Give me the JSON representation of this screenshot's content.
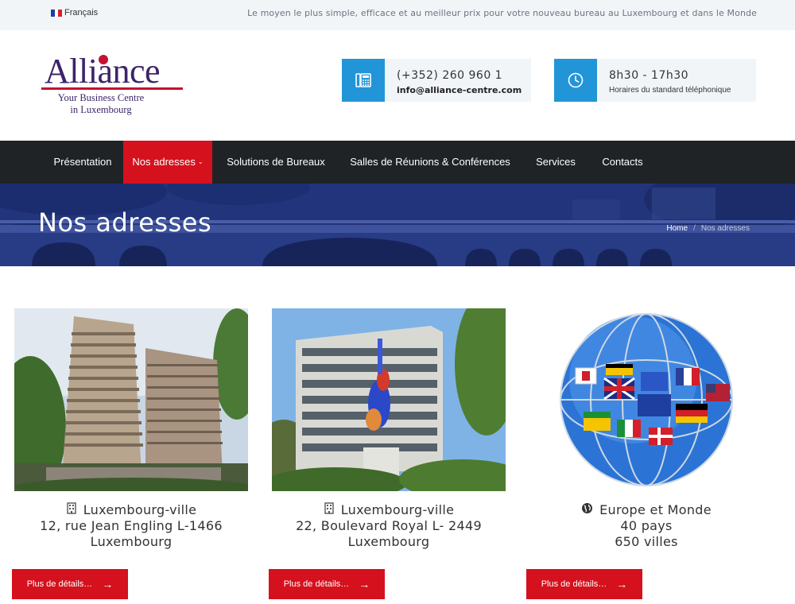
{
  "topbar": {
    "language": "Français",
    "tagline": "Le moyen le plus simple, efficace et au meilleur prix pour votre nouveau bureau au Luxembourg et dans le Monde"
  },
  "logo": {
    "word": "Alliance",
    "sub_line1": "Your Business Centre",
    "sub_line2": "in Luxembourg"
  },
  "contact": {
    "phone": "(+352) 260 960 1",
    "email": "info@alliance-centre.com",
    "hours": "8h30 - 17h30",
    "hours_label": "Horaires du standard téléphonique"
  },
  "nav": {
    "items": [
      {
        "label": "Présentation"
      },
      {
        "label": "Nos adresses",
        "active": true
      },
      {
        "label": "Solutions de Bureaux"
      },
      {
        "label": "Salles de Réunions & Conférences"
      },
      {
        "label": "Services"
      },
      {
        "label": "Contacts"
      }
    ]
  },
  "hero": {
    "title": "Nos adresses",
    "breadcrumb_home": "Home",
    "breadcrumb_sep": "/",
    "breadcrumb_current": "Nos adresses"
  },
  "cards": [
    {
      "line1": "Luxembourg-ville",
      "line2": "12, rue Jean Engling L-1466",
      "line3": "Luxembourg",
      "icon": "building-icon",
      "button": "Plus de détails…"
    },
    {
      "line1": "Luxembourg-ville",
      "line2": "22, Boulevard Royal  L- 2449",
      "line3": "Luxembourg",
      "icon": "building-icon",
      "button": "Plus de détails…"
    },
    {
      "line1": "Europe et Monde",
      "line2": "40 pays",
      "line3": "650 villes",
      "icon": "globe-icon",
      "button": "Plus de détails…"
    }
  ],
  "colors": {
    "brand_red": "#d5111d",
    "brand_blue": "#2295d8",
    "nav_bg": "#1f2326",
    "logo_purple": "#3d2469"
  }
}
